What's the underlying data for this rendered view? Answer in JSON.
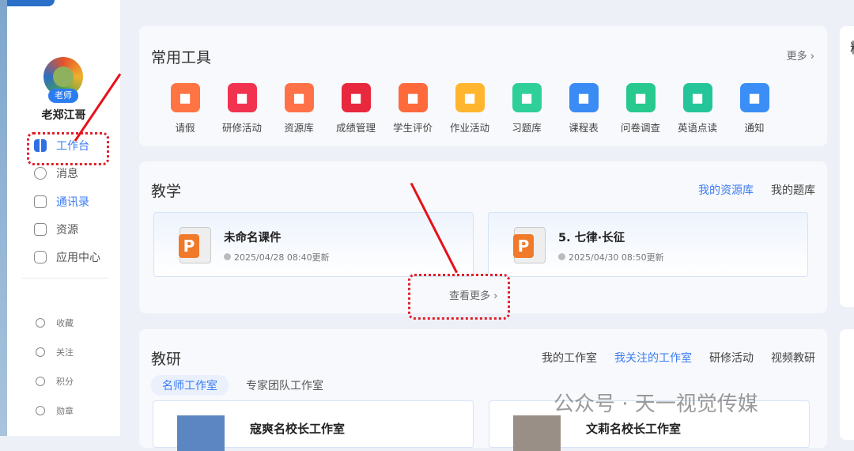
{
  "user": {
    "name": "老郑江哥",
    "role_badge": "老师"
  },
  "sidebar": {
    "items": [
      {
        "label": "工作台",
        "icon": "grid-icon",
        "active": true
      },
      {
        "label": "消息",
        "icon": "message-icon"
      },
      {
        "label": "通讯录",
        "icon": "contacts-icon"
      },
      {
        "label": "资源",
        "icon": "book-icon"
      },
      {
        "label": "应用中心",
        "icon": "app-center-icon"
      }
    ],
    "secondary": [
      {
        "label": "收藏",
        "icon": "heart-icon"
      },
      {
        "label": "关注",
        "icon": "follow-icon"
      },
      {
        "label": "积分",
        "icon": "points-icon"
      },
      {
        "label": "勋章",
        "icon": "medal-icon"
      }
    ]
  },
  "tools": {
    "title": "常用工具",
    "more": "更多 ›",
    "items": [
      {
        "label": "请假",
        "color": "#ff7443"
      },
      {
        "label": "研修活动",
        "color": "#f2334f"
      },
      {
        "label": "资源库",
        "color": "#ff7247"
      },
      {
        "label": "成绩管理",
        "color": "#e8283d"
      },
      {
        "label": "学生评价",
        "color": "#ff6a3d"
      },
      {
        "label": "作业活动",
        "color": "#ffb52e"
      },
      {
        "label": "习题库",
        "color": "#2fcf9a"
      },
      {
        "label": "课程表",
        "color": "#3b8bf5"
      },
      {
        "label": "问卷调查",
        "color": "#27c98e"
      },
      {
        "label": "英语点读",
        "color": "#25c59a"
      },
      {
        "label": "通知",
        "color": "#3a8ef6"
      }
    ]
  },
  "teaching": {
    "title": "教学",
    "links": [
      "我的资源库",
      "我的题库"
    ],
    "resources": [
      {
        "name": "未命名课件",
        "date": "2025/04/28 08:40更新"
      },
      {
        "name": "5. 七律·长征",
        "date": "2025/04/30 08:50更新"
      }
    ],
    "see_more": "查看更多 ›"
  },
  "research": {
    "title": "教研",
    "links": [
      "我的工作室",
      "我关注的工作室",
      "研修活动",
      "视频教研"
    ],
    "tabs": [
      "名师工作室",
      "专家团队工作室"
    ],
    "studios": [
      "寇爽名校长工作室",
      "文莉名校长工作室"
    ]
  },
  "right_panel": {
    "title_char": "精"
  },
  "watermark": "公众号 · 天一视觉传媒"
}
